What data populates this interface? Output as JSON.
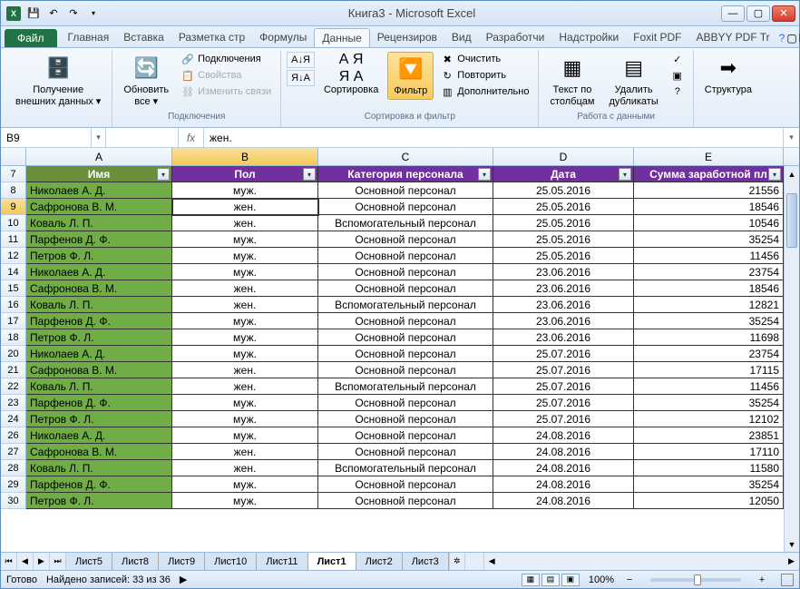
{
  "app": {
    "title": "Книга3  -  Microsoft Excel"
  },
  "ribbon_tabs": {
    "file": "Файл",
    "items": [
      "Главная",
      "Вставка",
      "Разметка стр",
      "Формулы",
      "Данные",
      "Рецензиров",
      "Вид",
      "Разработчи",
      "Надстройки",
      "Foxit PDF",
      "ABBYY PDF Tr"
    ],
    "active_index": 4
  },
  "ribbon": {
    "get_external": "Получение\nвнешних данных ▾",
    "refresh_all": "Обновить\nвсе ▾",
    "connections": "Подключения",
    "properties": "Свойства",
    "edit_links": "Изменить связи",
    "group_connections": "Подключения",
    "sort_label": "Сортировка",
    "sort_a": "А↓",
    "sort_ya": "Я↓",
    "filter": "Фильтр",
    "clear": "Очистить",
    "reapply": "Повторить",
    "advanced": "Дополнительно",
    "group_sortfilter": "Сортировка и фильтр",
    "text_to_cols": "Текст по\nстолбцам",
    "remove_dup": "Удалить\nдубликаты",
    "group_datatools": "Работа с данными",
    "structure": "Структура",
    "group_structure": ""
  },
  "formula_bar": {
    "name_box": "B9",
    "fx": "fx",
    "value": "жен."
  },
  "columns": [
    "A",
    "B",
    "C",
    "D",
    "E"
  ],
  "table_headers": {
    "name": "Имя",
    "gender": "Пол",
    "category": "Категория персонала",
    "date": "Дата",
    "salary": "Сумма заработной пл"
  },
  "rows": [
    {
      "n": 8,
      "name": "Николаев А. Д.",
      "gender": "муж.",
      "cat": "Основной персонал",
      "date": "25.05.2016",
      "sum": "21556"
    },
    {
      "n": 9,
      "name": "Сафронова В. М.",
      "gender": "жен.",
      "cat": "Основной персонал",
      "date": "25.05.2016",
      "sum": "18546",
      "active": true
    },
    {
      "n": 10,
      "name": "Коваль Л. П.",
      "gender": "жен.",
      "cat": "Вспомогательный персонал",
      "date": "25.05.2016",
      "sum": "10546"
    },
    {
      "n": 11,
      "name": "Парфенов Д. Ф.",
      "gender": "муж.",
      "cat": "Основной персонал",
      "date": "25.05.2016",
      "sum": "35254"
    },
    {
      "n": 12,
      "name": "Петров Ф. Л.",
      "gender": "муж.",
      "cat": "Основной персонал",
      "date": "25.05.2016",
      "sum": "11456"
    },
    {
      "n": 14,
      "name": "Николаев А. Д.",
      "gender": "муж.",
      "cat": "Основной персонал",
      "date": "23.06.2016",
      "sum": "23754"
    },
    {
      "n": 15,
      "name": "Сафронова В. М.",
      "gender": "жен.",
      "cat": "Основной персонал",
      "date": "23.06.2016",
      "sum": "18546"
    },
    {
      "n": 16,
      "name": "Коваль Л. П.",
      "gender": "жен.",
      "cat": "Вспомогательный персонал",
      "date": "23.06.2016",
      "sum": "12821"
    },
    {
      "n": 17,
      "name": "Парфенов Д. Ф.",
      "gender": "муж.",
      "cat": "Основной персонал",
      "date": "23.06.2016",
      "sum": "35254"
    },
    {
      "n": 18,
      "name": "Петров Ф. Л.",
      "gender": "муж.",
      "cat": "Основной персонал",
      "date": "23.06.2016",
      "sum": "11698"
    },
    {
      "n": 20,
      "name": "Николаев А. Д.",
      "gender": "муж.",
      "cat": "Основной персонал",
      "date": "25.07.2016",
      "sum": "23754"
    },
    {
      "n": 21,
      "name": "Сафронова В. М.",
      "gender": "жен.",
      "cat": "Основной персонал",
      "date": "25.07.2016",
      "sum": "17115"
    },
    {
      "n": 22,
      "name": "Коваль Л. П.",
      "gender": "жен.",
      "cat": "Вспомогательный персонал",
      "date": "25.07.2016",
      "sum": "11456"
    },
    {
      "n": 23,
      "name": "Парфенов Д. Ф.",
      "gender": "муж.",
      "cat": "Основной персонал",
      "date": "25.07.2016",
      "sum": "35254"
    },
    {
      "n": 24,
      "name": "Петров Ф. Л.",
      "gender": "муж.",
      "cat": "Основной персонал",
      "date": "25.07.2016",
      "sum": "12102"
    },
    {
      "n": 26,
      "name": "Николаев А. Д.",
      "gender": "муж.",
      "cat": "Основной персонал",
      "date": "24.08.2016",
      "sum": "23851"
    },
    {
      "n": 27,
      "name": "Сафронова В. М.",
      "gender": "жен.",
      "cat": "Основной персонал",
      "date": "24.08.2016",
      "sum": "17110"
    },
    {
      "n": 28,
      "name": "Коваль Л. П.",
      "gender": "жен.",
      "cat": "Вспомогательный персонал",
      "date": "24.08.2016",
      "sum": "11580"
    },
    {
      "n": 29,
      "name": "Парфенов Д. Ф.",
      "gender": "муж.",
      "cat": "Основной персонал",
      "date": "24.08.2016",
      "sum": "35254"
    },
    {
      "n": 30,
      "name": "Петров Ф. Л.",
      "gender": "муж.",
      "cat": "Основной персонал",
      "date": "24.08.2016",
      "sum": "12050"
    }
  ],
  "sheet_tabs": [
    "Лист5",
    "Лист8",
    "Лист9",
    "Лист10",
    "Лист11",
    "Лист1",
    "Лист2",
    "Лист3"
  ],
  "sheet_tabs_active": 5,
  "statusbar": {
    "ready": "Готово",
    "records": "Найдено записей: 33 из 36",
    "zoom": "100%"
  }
}
